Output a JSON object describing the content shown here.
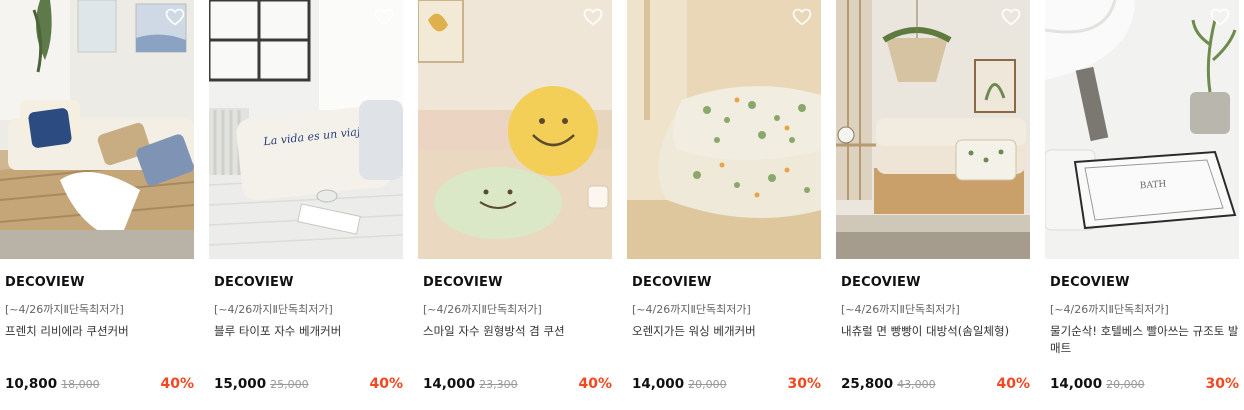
{
  "products": [
    {
      "brand": "DECOVIEW",
      "promo": "[~4/26까지Ⅱ단독최저가]",
      "name": "프렌치 리비에라 쿠션커버",
      "price": "10,800",
      "original_price": "18,000",
      "discount": "40%",
      "scene": "sofa-room",
      "palette": {
        "bg": "#ecece8",
        "main": "#f2ede3",
        "accent": "#2f4b7a"
      }
    },
    {
      "brand": "DECOVIEW",
      "promo": "[~4/26까지Ⅱ단독최저가]",
      "name": "블루 타이포 자수 베개커버",
      "price": "15,000",
      "original_price": "25,000",
      "discount": "40%",
      "scene": "bed-pillow",
      "palette": {
        "bg": "#f3f3f1",
        "main": "#f4f1ea",
        "accent": "#2a3f7a"
      }
    },
    {
      "brand": "DECOVIEW",
      "promo": "[~4/26까지Ⅱ단독최저가]",
      "name": "스마일 자수 원형방석 겸 쿠션",
      "price": "14,000",
      "original_price": "23,300",
      "discount": "40%",
      "scene": "smile-cushions",
      "palette": {
        "bg": "#efe6da",
        "main": "#f2cf55",
        "accent": "#d9e6c6"
      }
    },
    {
      "brand": "DECOVIEW",
      "promo": "[~4/26까지Ⅱ단독최저가]",
      "name": "오렌지가든 워싱 베개커버",
      "price": "14,000",
      "original_price": "20,000",
      "discount": "30%",
      "scene": "floral-pillows",
      "palette": {
        "bg": "#e6d3b3",
        "main": "#f1ede0",
        "accent": "#8aa86b"
      }
    },
    {
      "brand": "DECOVIEW",
      "promo": "[~4/26까지Ⅱ단독최저가]",
      "name": "내츄럴 면 빵빵이 대방석(솜일체형)",
      "price": "25,800",
      "original_price": "43,000",
      "discount": "40%",
      "scene": "pallet-sofa",
      "palette": {
        "bg": "#e9e4dc",
        "main": "#eee5d6",
        "accent": "#c9a06a"
      }
    },
    {
      "brand": "DECOVIEW",
      "promo": "[~4/26까지Ⅱ단독최저가]",
      "name": "물기순삭! 호텔베스 빨아쓰는 규조토 발매트",
      "price": "14,000",
      "original_price": "20,000",
      "discount": "30%",
      "scene": "bath-mat",
      "palette": {
        "bg": "#f1f1ef",
        "main": "#fafafa",
        "accent": "#3a3a3a"
      }
    }
  ],
  "icons": {
    "wishlist": "heart-outline-icon"
  },
  "colors": {
    "discount": "#f24822",
    "original_price": "#999999"
  }
}
